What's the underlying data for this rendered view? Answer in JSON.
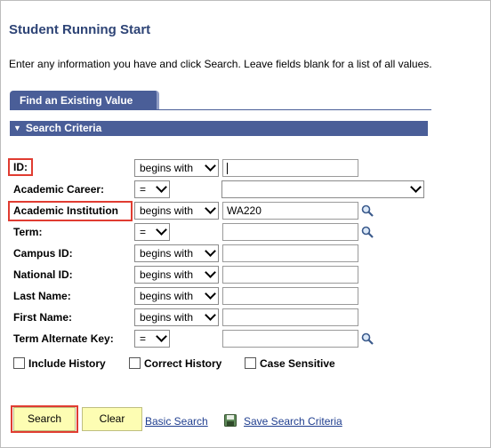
{
  "page": {
    "title": "Student Running Start",
    "instructions": "Enter any information you have and click Search. Leave fields blank for a list of all values."
  },
  "tab": {
    "label": "Find an Existing Value"
  },
  "section": {
    "label": "Search Criteria"
  },
  "fields": {
    "id": {
      "label": "ID:",
      "operator": "begins with",
      "value": ""
    },
    "academic_career": {
      "label": "Academic Career:",
      "operator": "=",
      "value": ""
    },
    "academic_institution": {
      "label": "Academic Institution",
      "operator": "begins with",
      "value": "WA220"
    },
    "term": {
      "label": "Term:",
      "operator": "=",
      "value": ""
    },
    "campus_id": {
      "label": "Campus ID:",
      "operator": "begins with",
      "value": ""
    },
    "national_id": {
      "label": "National ID:",
      "operator": "begins with",
      "value": ""
    },
    "last_name": {
      "label": "Last Name:",
      "operator": "begins with",
      "value": ""
    },
    "first_name": {
      "label": "First Name:",
      "operator": "begins with",
      "value": ""
    },
    "term_alternate_key": {
      "label": "Term Alternate Key:",
      "operator": "=",
      "value": ""
    }
  },
  "options": {
    "include_history": {
      "label": "Include History",
      "checked": false
    },
    "correct_history": {
      "label": "Correct History",
      "checked": false
    },
    "case_sensitive": {
      "label": "Case Sensitive",
      "checked": false
    }
  },
  "actions": {
    "search": "Search",
    "clear": "Clear",
    "basic_search": "Basic Search",
    "save_search_criteria": "Save Search Criteria"
  },
  "icons": {
    "lookup": "magnifier-icon",
    "save": "save-disk-icon",
    "collapse": "triangle-down-icon"
  },
  "colors": {
    "header_blue": "#4a5e98",
    "title_blue": "#2e4476",
    "highlight_red": "#e03c31",
    "button_yellow": "#fdfdb3",
    "link_blue": "#1f3e8f"
  }
}
